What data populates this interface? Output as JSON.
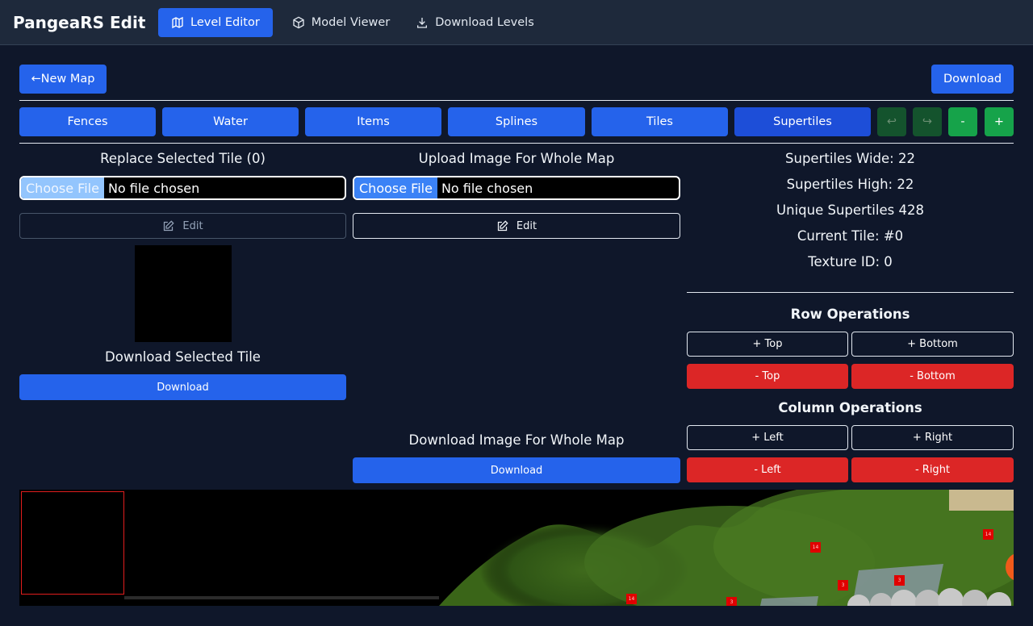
{
  "brand": "PangeaRS Edit",
  "nav": [
    {
      "label": "Level Editor",
      "icon": "map-icon",
      "active": true
    },
    {
      "label": "Model Viewer",
      "icon": "cube-icon",
      "active": false
    },
    {
      "label": "Download Levels",
      "icon": "download-icon",
      "active": false
    }
  ],
  "toolbar": {
    "new_map": "←New Map",
    "download": "Download"
  },
  "tabs": [
    "Fences",
    "Water",
    "Items",
    "Splines",
    "Tiles",
    "Supertiles"
  ],
  "tool_buttons": {
    "undo": "↩",
    "redo": "↪",
    "minus": "-",
    "plus": "+"
  },
  "left": {
    "replace_title": "Replace Selected Tile (0)",
    "choose_file": "Choose File",
    "no_file": "No file chosen",
    "edit": "Edit",
    "download_title": "Download Selected Tile",
    "download": "Download"
  },
  "middle": {
    "upload_title": "Upload Image For Whole Map",
    "choose_file": "Choose File",
    "no_file": "No file chosen",
    "edit": "Edit",
    "download_title": "Download Image For Whole Map",
    "download": "Download"
  },
  "stats": {
    "wide": "Supertiles Wide: 22",
    "high": "Supertiles High: 22",
    "unique": "Unique Supertiles 428",
    "current": "Current Tile: #0",
    "texture": "Texture ID: 0"
  },
  "rows": {
    "title": "Row Operations",
    "add_top": "+ Top",
    "add_bottom": "+ Bottom",
    "rm_top": "- Top",
    "rm_bottom": "- Bottom"
  },
  "cols": {
    "title": "Column Operations",
    "add_left": "+ Left",
    "add_right": "+ Right",
    "rm_left": "- Left",
    "rm_right": "- Right"
  },
  "map_markers": [
    "14",
    "14",
    "3",
    "3",
    "14",
    "3"
  ],
  "colors": {
    "primary": "#2563eb",
    "danger": "#dc2626",
    "success": "#16a34a",
    "background": "#0f172a",
    "header": "#1e293b"
  }
}
